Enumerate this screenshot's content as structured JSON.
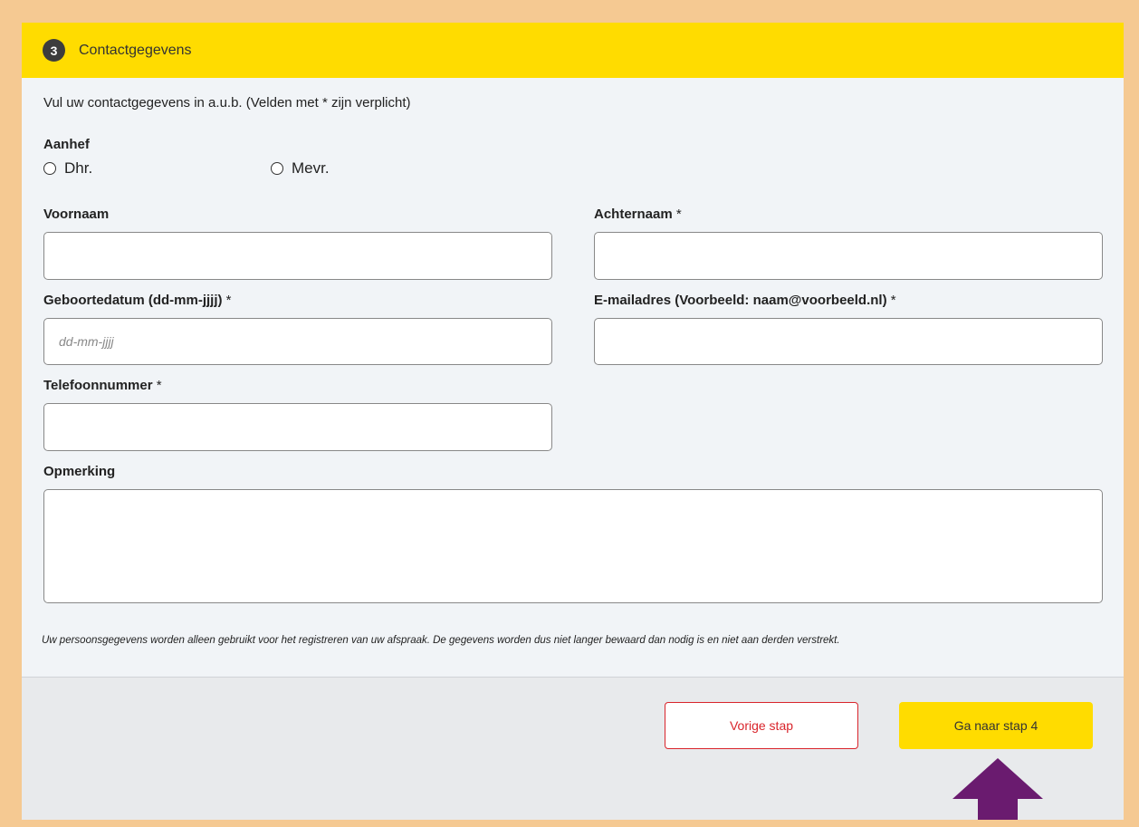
{
  "step": {
    "number": "3",
    "title": "Contactgegevens"
  },
  "intro": "Vul uw contactgegevens in a.u.b. (Velden met * zijn verplicht)",
  "salutation": {
    "label": "Aanhef",
    "options": [
      "Dhr.",
      "Mevr."
    ]
  },
  "fields": {
    "first_name": {
      "label": "Voornaam"
    },
    "last_name": {
      "label": "Achternaam",
      "required": "*"
    },
    "birthdate": {
      "label": "Geboortedatum (dd-mm-jjjj)",
      "required": "*",
      "placeholder": "dd-mm-jjjj"
    },
    "email": {
      "label": "E-mailadres (Voorbeeld: naam@voorbeeld.nl)",
      "required": "*"
    },
    "phone": {
      "label": "Telefoonnummer",
      "required": "*"
    },
    "remark": {
      "label": "Opmerking"
    }
  },
  "privacy_notice": "Uw persoonsgegevens worden alleen gebruikt voor het registreren van uw afspraak. De gegevens worden dus niet langer bewaard dan nodig is en niet aan derden verstrekt.",
  "buttons": {
    "previous": "Vorige stap",
    "next": "Ga naar stap 4"
  },
  "colors": {
    "header": "#ffdc00",
    "button_next": "#ffdc00",
    "button_prev_border": "#d9242b",
    "arrow": "#6a1b6f"
  }
}
